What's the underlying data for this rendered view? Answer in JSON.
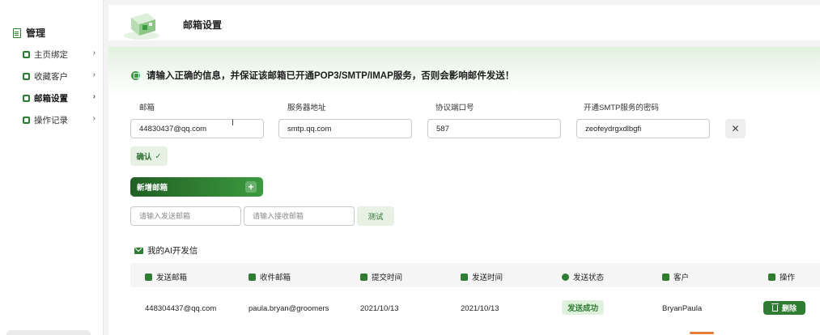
{
  "sidebar": {
    "title": "管理",
    "items": [
      {
        "label": "主页绑定"
      },
      {
        "label": "收藏客户"
      },
      {
        "label": "邮箱设置"
      },
      {
        "label": "操作记录"
      }
    ],
    "chevron": "›"
  },
  "header": {
    "title": "邮箱设置"
  },
  "notice": "请输入正确的信息，并保证该邮箱已开通POP3/SMTP/IMAP服务，否则会影响邮件发送！",
  "form": {
    "email_label": "邮箱",
    "email_value": "44830437@qq.com",
    "server_label": "服务器地址",
    "server_value": "smtp.qq.com",
    "port_label": "协议端口号",
    "port_value": "587",
    "password_label": "开通SMTP服务的密码",
    "password_value": "zeofeydrgxdlbgfi",
    "close_icon": "✕",
    "confirm_label": "确认",
    "confirm_icon": "✓"
  },
  "add_mailbox": {
    "label": "新增邮箱",
    "plus": "+"
  },
  "test": {
    "send_placeholder": "请输入发送邮箱",
    "receive_placeholder": "请输入接收邮箱",
    "button_label": "测试"
  },
  "letters": {
    "title": "我的AI开发信",
    "columns": [
      "发送邮箱",
      "收件邮箱",
      "提交时间",
      "发送时间",
      "发送状态",
      "客户",
      "操作"
    ],
    "rows": [
      {
        "sender": "448304437@qq.com",
        "recipient": "paula.bryan@groomers",
        "submit_time": "2021/10/13",
        "send_time": "2021/10/13",
        "status": "发送成功",
        "customer": "BryanPaula",
        "action": "删除"
      }
    ]
  },
  "colors": {
    "brand": "#2e7d32",
    "brand_light": "#e7f2e4",
    "accent_orange": "#e57a3a"
  },
  "icons": {
    "sidebar_title": "document-icon",
    "notice": "info-badge-icon",
    "section": "envelope-icon",
    "columns": [
      "envelope-icon",
      "mailbox-icon",
      "calendar-icon",
      "calendar-check-icon",
      "info-icon",
      "user-icon",
      "hand-pointer-icon"
    ],
    "delete": "trash-icon"
  }
}
